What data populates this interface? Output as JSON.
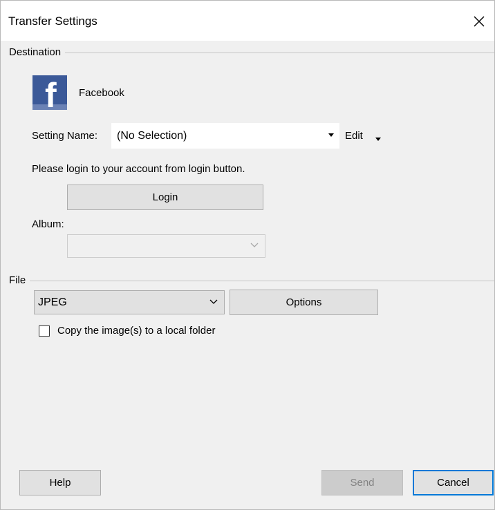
{
  "window": {
    "title": "Transfer Settings",
    "close_icon": "close-icon"
  },
  "destination": {
    "group_label": "Destination",
    "service_name": "Facebook",
    "service_icon": "facebook-logo-icon",
    "brand_color": "#3b5998",
    "setting_name_label": "Setting Name:",
    "setting_name_value": "(No Selection)",
    "edit_label": "Edit",
    "login_prompt": "Please login to your account from login button.",
    "login_button": "Login",
    "album_label": "Album:",
    "album_value": ""
  },
  "file": {
    "group_label": "File",
    "format_value": "JPEG",
    "options_button": "Options",
    "copy_checkbox_label": "Copy the image(s) to a local folder",
    "copy_checked": false
  },
  "footer": {
    "help_button": "Help",
    "send_button": "Send",
    "cancel_button": "Cancel",
    "accent_color": "#0078d7"
  }
}
